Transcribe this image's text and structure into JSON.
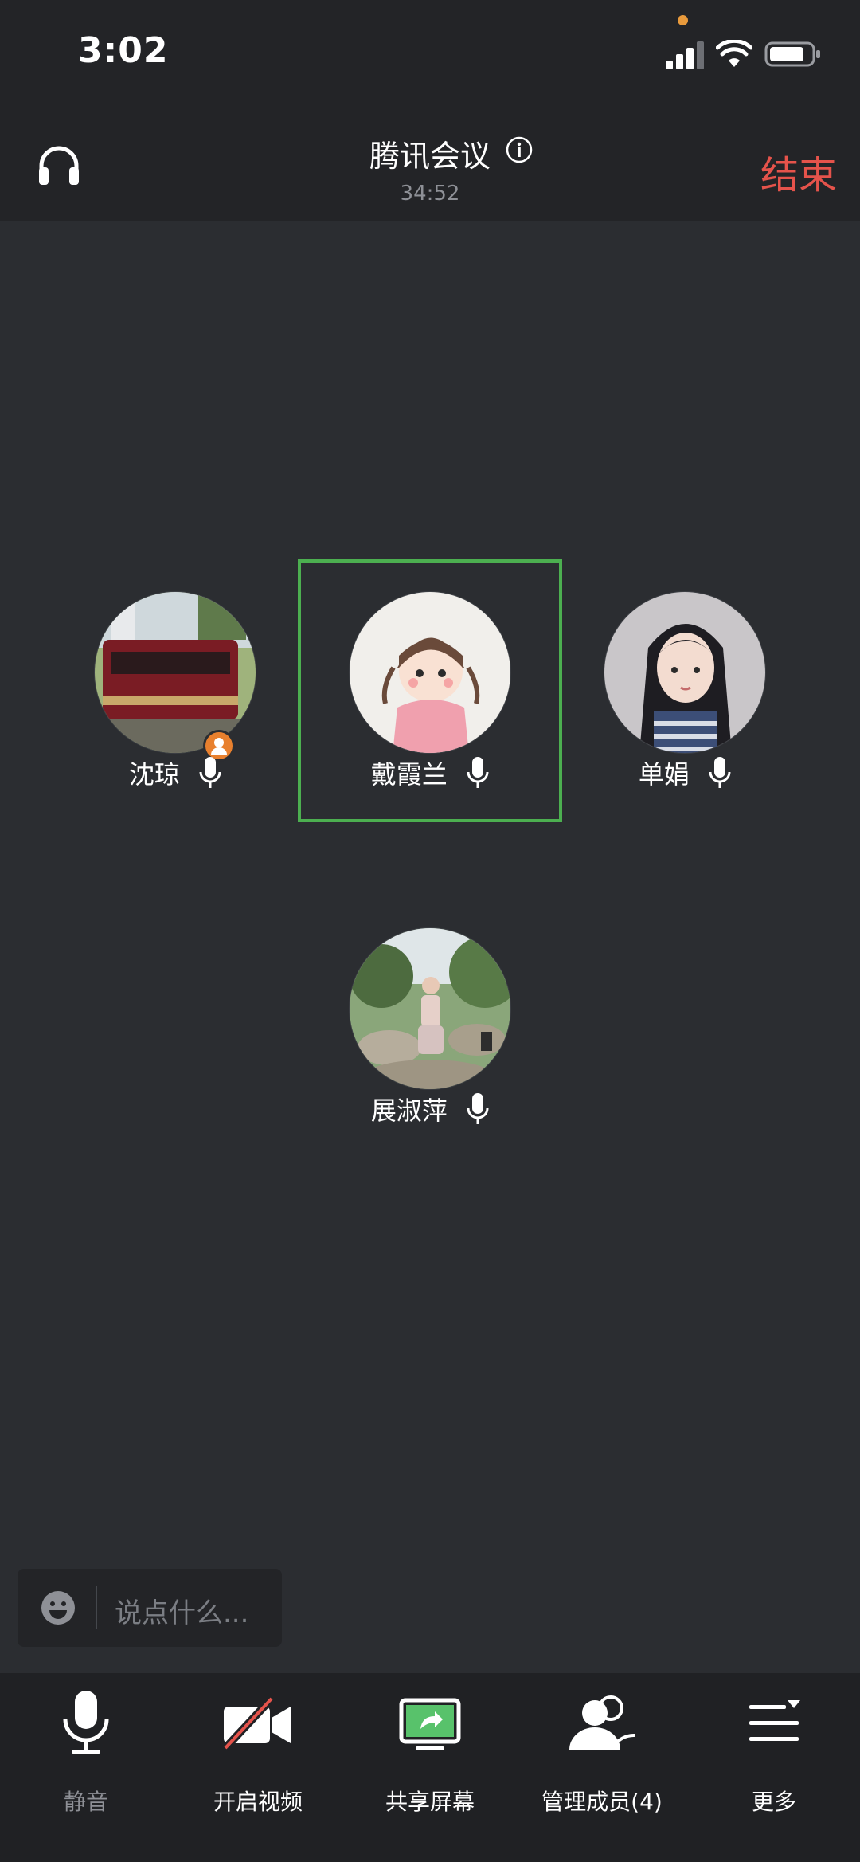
{
  "status_bar": {
    "time": "3:02"
  },
  "header": {
    "title": "腾讯会议",
    "timer": "34:52",
    "end_label": "结束"
  },
  "participants": [
    {
      "name": "沈琼",
      "is_host": true
    },
    {
      "name": "戴霞兰",
      "is_active_speaker": true
    },
    {
      "name": "单娟"
    },
    {
      "name": "展淑萍"
    }
  ],
  "chat": {
    "placeholder": "说点什么..."
  },
  "toolbar": {
    "mute_label": "静音",
    "video_label": "开启视频",
    "share_label": "共享屏幕",
    "members_label": "管理成员(4)",
    "more_label": "更多"
  },
  "colors": {
    "end_red": "#e5534b",
    "active_green": "#4caf50",
    "host_orange": "#e8802e",
    "share_green": "#58c26b"
  }
}
